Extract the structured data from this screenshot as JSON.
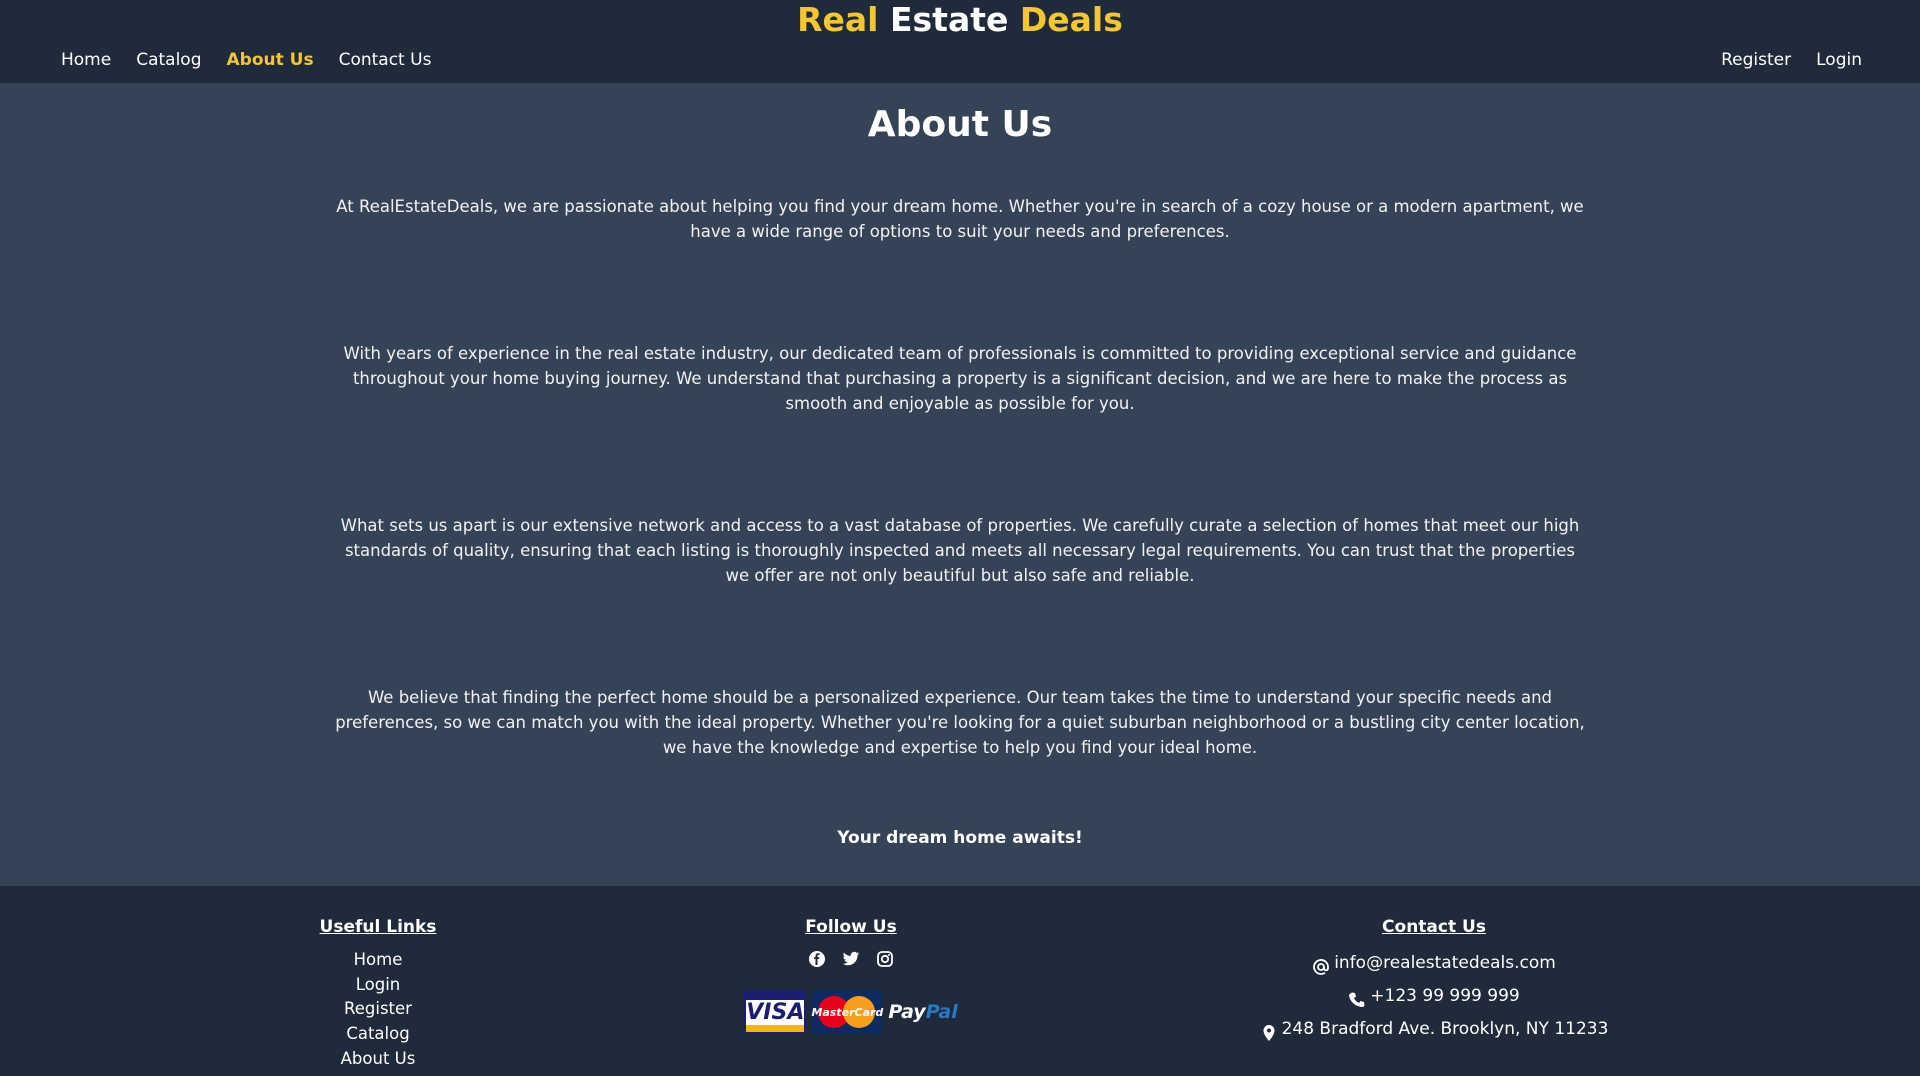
{
  "header": {
    "brand_part1": "Real",
    "brand_part2": "Estate",
    "brand_part3": "Deals",
    "nav": [
      "Home",
      "Catalog",
      "About Us",
      "Contact Us"
    ],
    "active": "About Us",
    "auth": [
      "Register",
      "Login"
    ]
  },
  "main": {
    "title": "About Us",
    "paragraphs": [
      "At RealEstateDeals, we are passionate about helping you find your dream home. Whether you're in search of a cozy house or a modern apartment, we have a wide range of options to suit your needs and preferences.",
      "With years of experience in the real estate industry, our dedicated team of professionals is committed to providing exceptional service and guidance throughout your home buying journey. We understand that purchasing a property is a significant decision, and we are here to make the process as smooth and enjoyable as possible for you.",
      "What sets us apart is our extensive network and access to a vast database of properties. We carefully curate a selection of homes that meet our high standards of quality, ensuring that each listing is thoroughly inspected and meets all necessary legal requirements. You can trust that the properties we offer are not only beautiful but also safe and reliable.",
      "We believe that finding the perfect home should be a personalized experience. Our team takes the time to understand your specific needs and preferences, so we can match you with the ideal property. Whether you're looking for a quiet suburban neighborhood or a bustling city center location, we have the knowledge and expertise to help you find your ideal home."
    ],
    "tagline": "Your dream home awaits!"
  },
  "footer": {
    "useful_links_title": "Useful Links",
    "useful_links": [
      "Home",
      "Login",
      "Register",
      "Catalog",
      "About Us"
    ],
    "follow_title": "Follow Us",
    "social_icons": [
      "facebook-icon",
      "twitter-icon",
      "instagram-icon"
    ],
    "payments": {
      "visa": "VISA",
      "mastercard": "MasterCard",
      "paypal_a": "Pay",
      "paypal_b": "Pal"
    },
    "contact_title": "Contact Us",
    "email": "info@realestatedeals.com",
    "phone": "+123 99 999 999",
    "address": "248 Bradford Ave. Brooklyn, NY 11233"
  },
  "colors": {
    "accent": "#f5c630",
    "header_bg": "#1f2a3b",
    "body_bg": "#354357"
  }
}
